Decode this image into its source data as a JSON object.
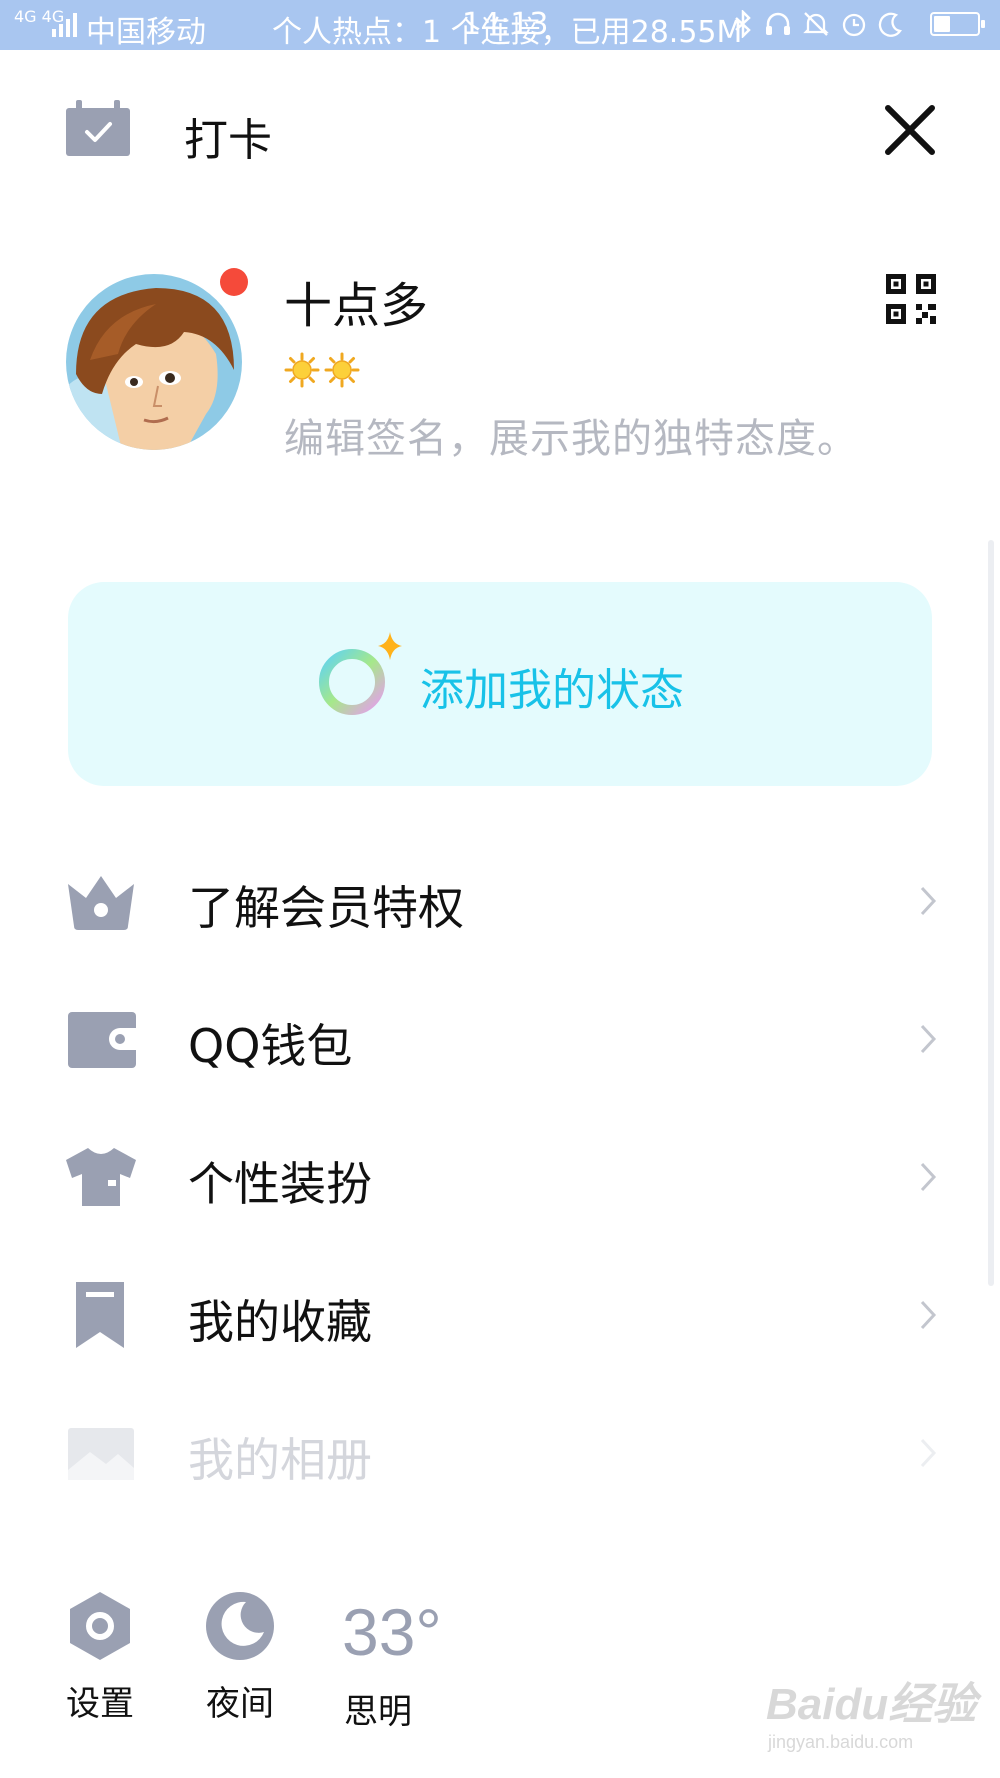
{
  "status_bar": {
    "network": "4G 4G",
    "carrier": "中国移动",
    "hotspot": "个人热点：1 个连接，已用28.55M",
    "time": "14:13",
    "icons": [
      "bluetooth-icon",
      "headset-icon",
      "silent-bell-icon",
      "alarm-icon",
      "moon-icon",
      "battery-icon"
    ]
  },
  "header": {
    "title": "打卡",
    "left_icon": "calendar-check-icon",
    "right_icon": "close-icon"
  },
  "profile": {
    "name": "十点多",
    "signature": "编辑签名，展示我的独特态度。",
    "level_icons": [
      "sun-icon",
      "sun-icon"
    ],
    "has_notification": true,
    "qr_icon": "qr-code-icon"
  },
  "status_card": {
    "label": "添加我的状态",
    "bg_color": "#e4fbfd",
    "text_color": "#18c2e8"
  },
  "menu": [
    {
      "label": "了解会员特权",
      "icon": "crown-icon",
      "faded": false
    },
    {
      "label": "QQ钱包",
      "icon": "wallet-icon",
      "faded": false
    },
    {
      "label": "个性装扮",
      "icon": "tshirt-icon",
      "faded": false
    },
    {
      "label": "我的收藏",
      "icon": "bookmark-icon",
      "faded": false
    },
    {
      "label": "我的相册",
      "icon": "photo-icon",
      "faded": true
    }
  ],
  "toolbar": {
    "settings_label": "设置",
    "night_label": "夜间",
    "weather_temp": "33°",
    "weather_city": "思明"
  },
  "watermark": {
    "logo": "Baidu经验",
    "url": "jingyan.baidu.com"
  },
  "colors": {
    "icon_gray": "#9aa0b2",
    "accent_cyan": "#18c2e8",
    "notify_red": "#f54a3a"
  }
}
